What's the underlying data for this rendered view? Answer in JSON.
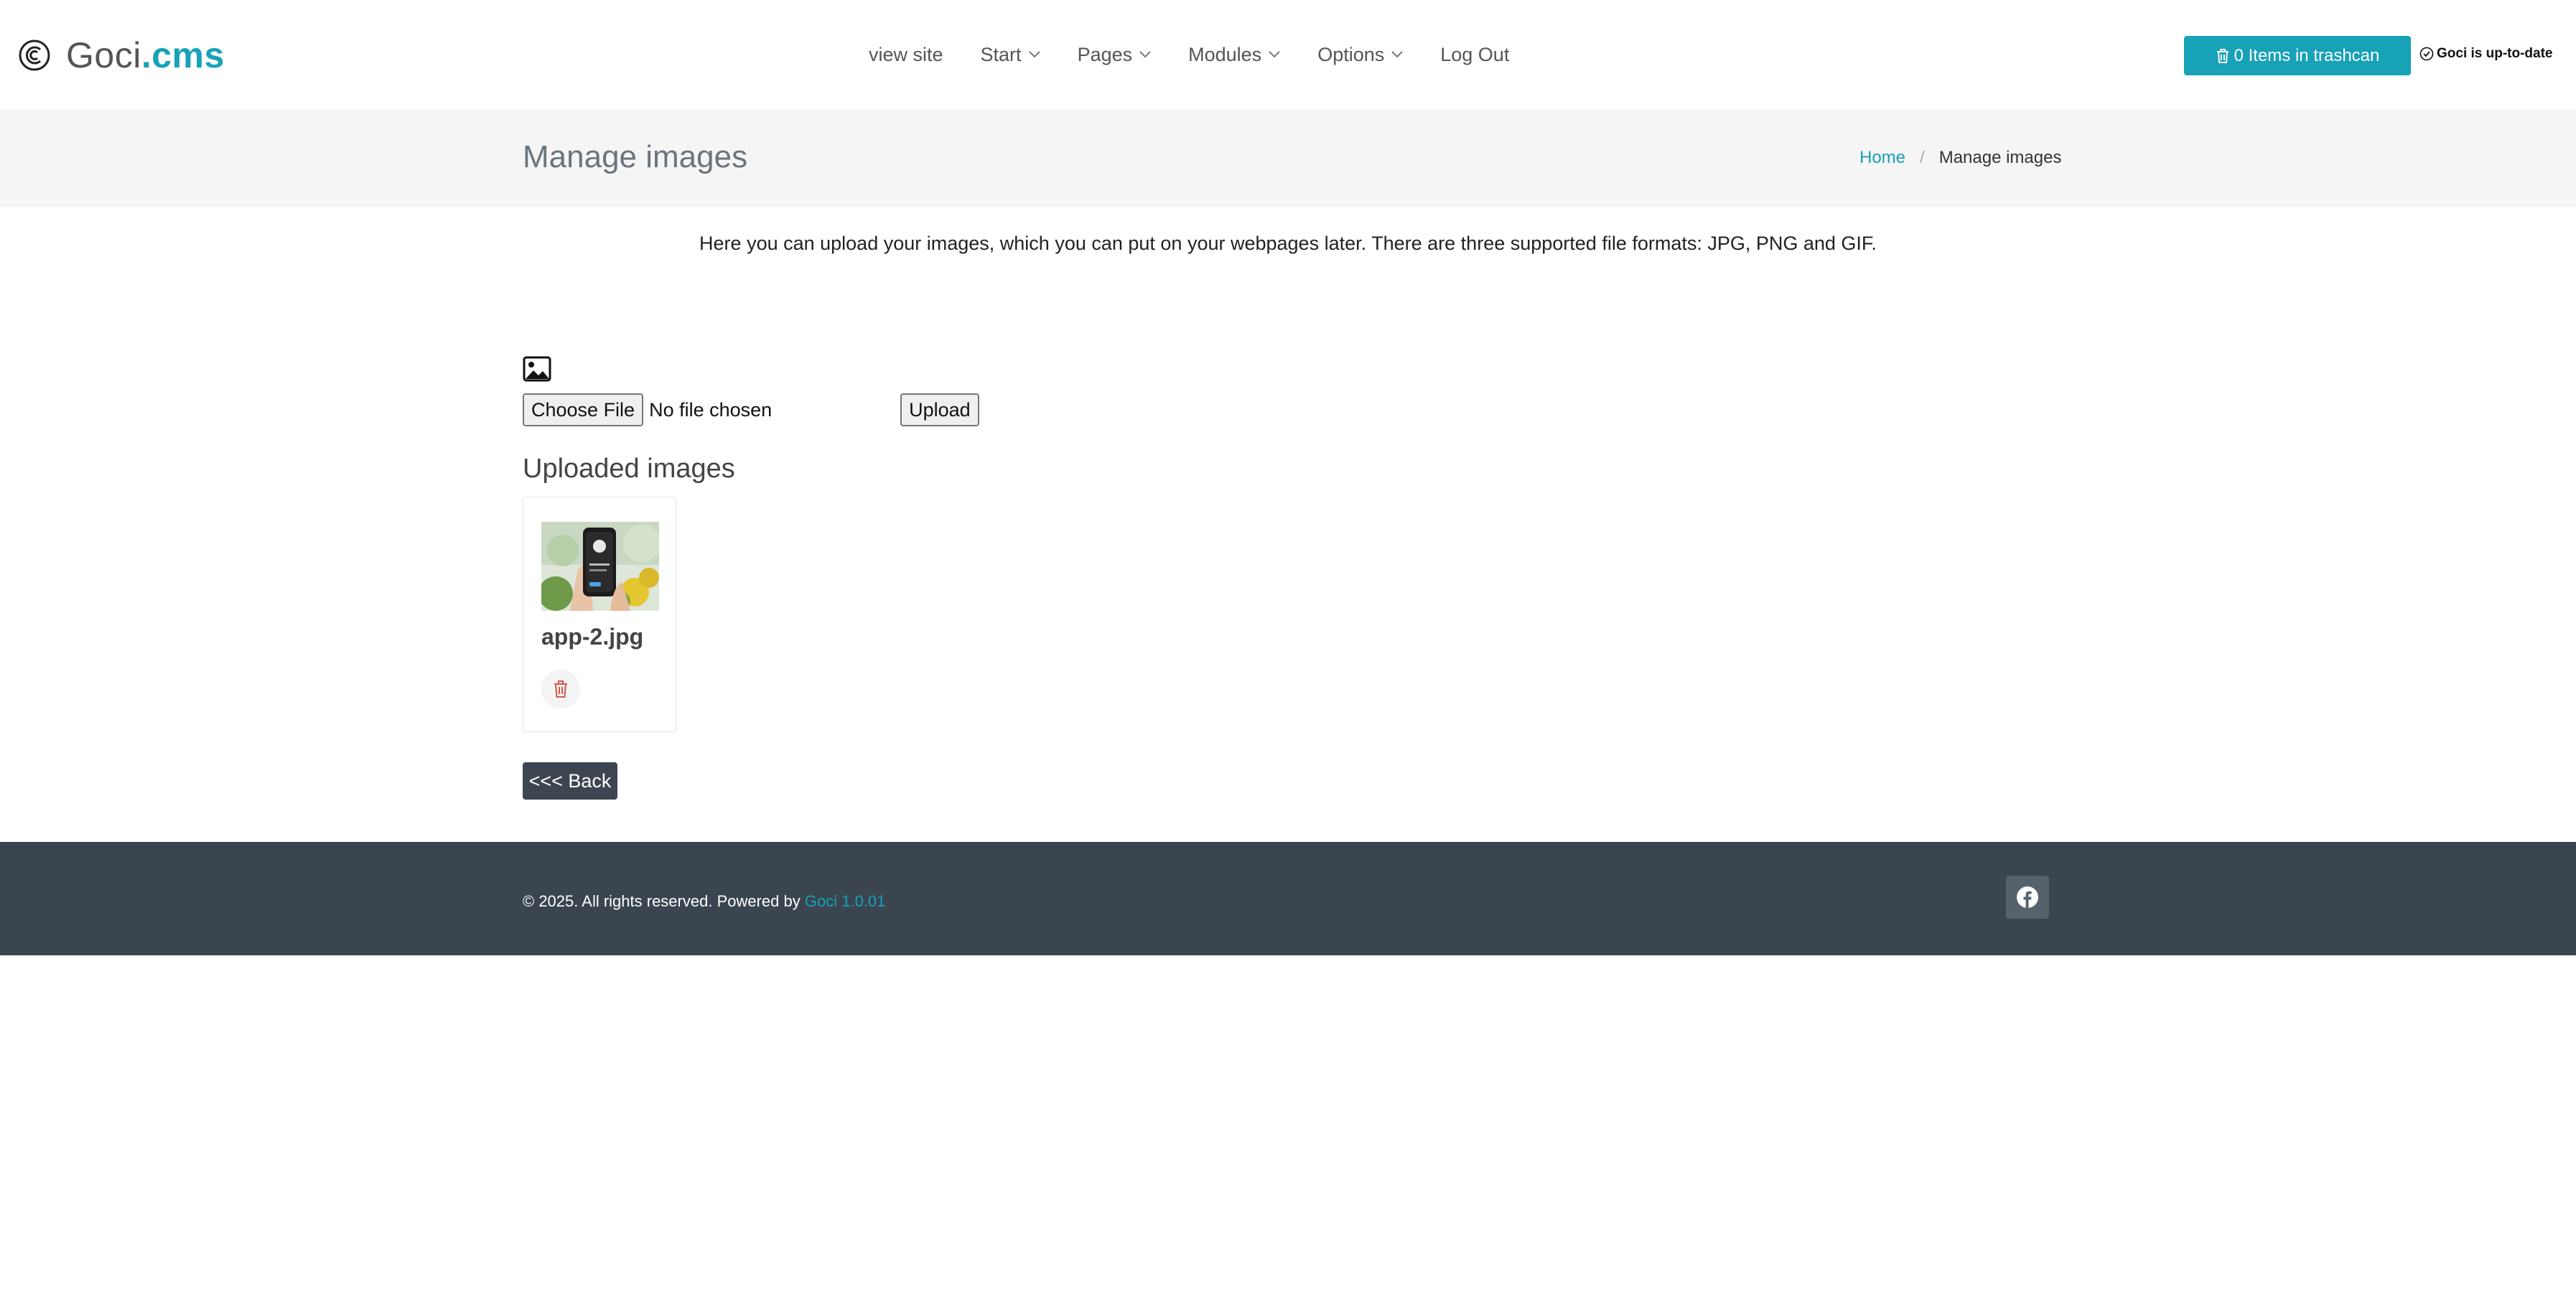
{
  "header": {
    "logo": {
      "text_main": "Goci",
      "text_accent": ".cms"
    },
    "nav": [
      {
        "label": "view site",
        "dropdown": false
      },
      {
        "label": "Start",
        "dropdown": true
      },
      {
        "label": "Pages",
        "dropdown": true
      },
      {
        "label": "Modules",
        "dropdown": true
      },
      {
        "label": "Options",
        "dropdown": true
      },
      {
        "label": "Log Out",
        "dropdown": false
      }
    ],
    "trash_button": {
      "label": "0 Items in trashcan",
      "icon": "trash-icon"
    },
    "status": {
      "label": "Goci is up-to-date",
      "icon": "check-circle-icon"
    }
  },
  "titlebar": {
    "title": "Manage images",
    "breadcrumb": {
      "home": "Home",
      "current": "Manage images"
    }
  },
  "main": {
    "intro": "Here you can upload your images, which you can put on your webpages later. There are three supported file formats: JPG, PNG and GIF.",
    "upload_icon": "image-icon",
    "file_input": {
      "button_label": "Choose File",
      "status": "No file chosen"
    },
    "upload_label": "Upload",
    "uploaded_title": "Uploaded images",
    "images": [
      {
        "name": "app-2.jpg",
        "delete_icon": "trash-icon"
      }
    ],
    "back_label": "<<< Back"
  },
  "footer": {
    "text": "© 2025. All rights reserved. Powered by",
    "link": "Goci 1.0.01",
    "social_icon": "facebook-icon"
  },
  "colors": {
    "accent": "#17a2b8",
    "footer_bg": "#3a4550",
    "titlebar_bg": "#f5f5f5",
    "back_button_bg": "#3d4650",
    "delete_icon": "#d9534f"
  }
}
